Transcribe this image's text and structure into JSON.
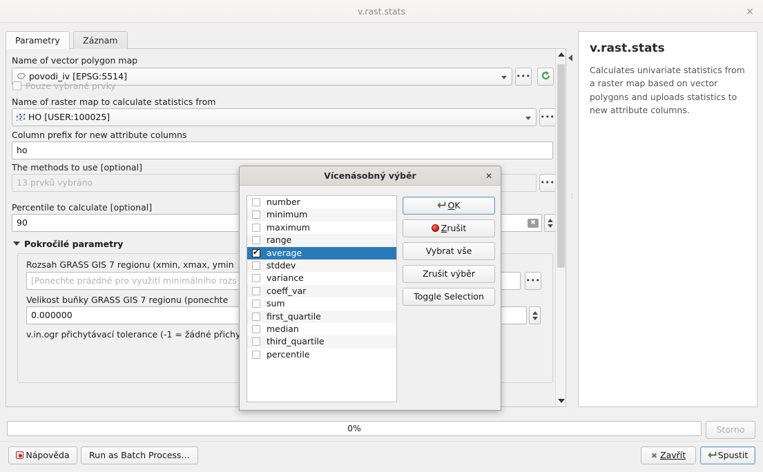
{
  "window": {
    "title": "v.rast.stats",
    "close_label": "×"
  },
  "tabs": [
    {
      "label": "Parametry",
      "active": true
    },
    {
      "label": "Záznam",
      "active": false
    }
  ],
  "form": {
    "vector_label": "Name of vector polygon map",
    "vector_value": "povodi_iv [EPSG:5514]",
    "selected_only_label": "Pouze vybrané prvky",
    "raster_label": "Name of raster map to calculate statistics from",
    "raster_value": "HO [USER:100025]",
    "prefix_label": "Column prefix for new attribute columns",
    "prefix_value": "ho",
    "methods_label": "The methods to use [optional]",
    "methods_value": "13 prvků vybráno",
    "percentile_label": "Percentile to calculate [optional]",
    "percentile_value": "90",
    "advanced_label": "Pokročilé parametry",
    "region_extent_label": "Rozsah GRASS GIS 7 regionu (xmin, xmax, ymin",
    "region_extent_placeholder": "[Ponechte prázdné pro využití minimálního rozs",
    "cellsize_label": "Velikost buňky GRASS GIS 7 regionu (ponechte",
    "cellsize_value": "0.000000",
    "snap_label": "v.in.ogr přichytávací tolerance (-1 = žádné přichy",
    "ellipsis_label": "•••"
  },
  "help": {
    "title": "v.rast.stats",
    "description": "Calculates univariate statistics from a raster map based on vector polygons and uploads statistics to new attribute columns."
  },
  "progress": {
    "value_label": "0%",
    "cancel_label": "Storno"
  },
  "footer": {
    "help_label": "Nápověda",
    "batch_label": "Run as Batch Process…",
    "close_label": "Zavřít",
    "run_label": "Spustit"
  },
  "modal": {
    "title": "Vícenásobný výběr",
    "close_label": "✕",
    "items": [
      {
        "label": "number",
        "checked": false,
        "selected": false
      },
      {
        "label": "minimum",
        "checked": false,
        "selected": false
      },
      {
        "label": "maximum",
        "checked": false,
        "selected": false
      },
      {
        "label": "range",
        "checked": false,
        "selected": false
      },
      {
        "label": "average",
        "checked": true,
        "selected": true
      },
      {
        "label": "stddev",
        "checked": false,
        "selected": false
      },
      {
        "label": "variance",
        "checked": false,
        "selected": false
      },
      {
        "label": "coeff_var",
        "checked": false,
        "selected": false
      },
      {
        "label": "sum",
        "checked": false,
        "selected": false
      },
      {
        "label": "first_quartile",
        "checked": false,
        "selected": false
      },
      {
        "label": "median",
        "checked": false,
        "selected": false
      },
      {
        "label": "third_quartile",
        "checked": false,
        "selected": false
      },
      {
        "label": "percentile",
        "checked": false,
        "selected": false
      }
    ],
    "buttons": {
      "ok": "OK",
      "cancel": "Zrušit",
      "select_all": "Vybrat vše",
      "deselect_all": "Zrušit výběr",
      "toggle": "Toggle Selection"
    }
  },
  "colors": {
    "selection_blue": "#2a7ab9",
    "window_bg": "#f0f0f0",
    "accent_border": "#6f9dc6"
  }
}
